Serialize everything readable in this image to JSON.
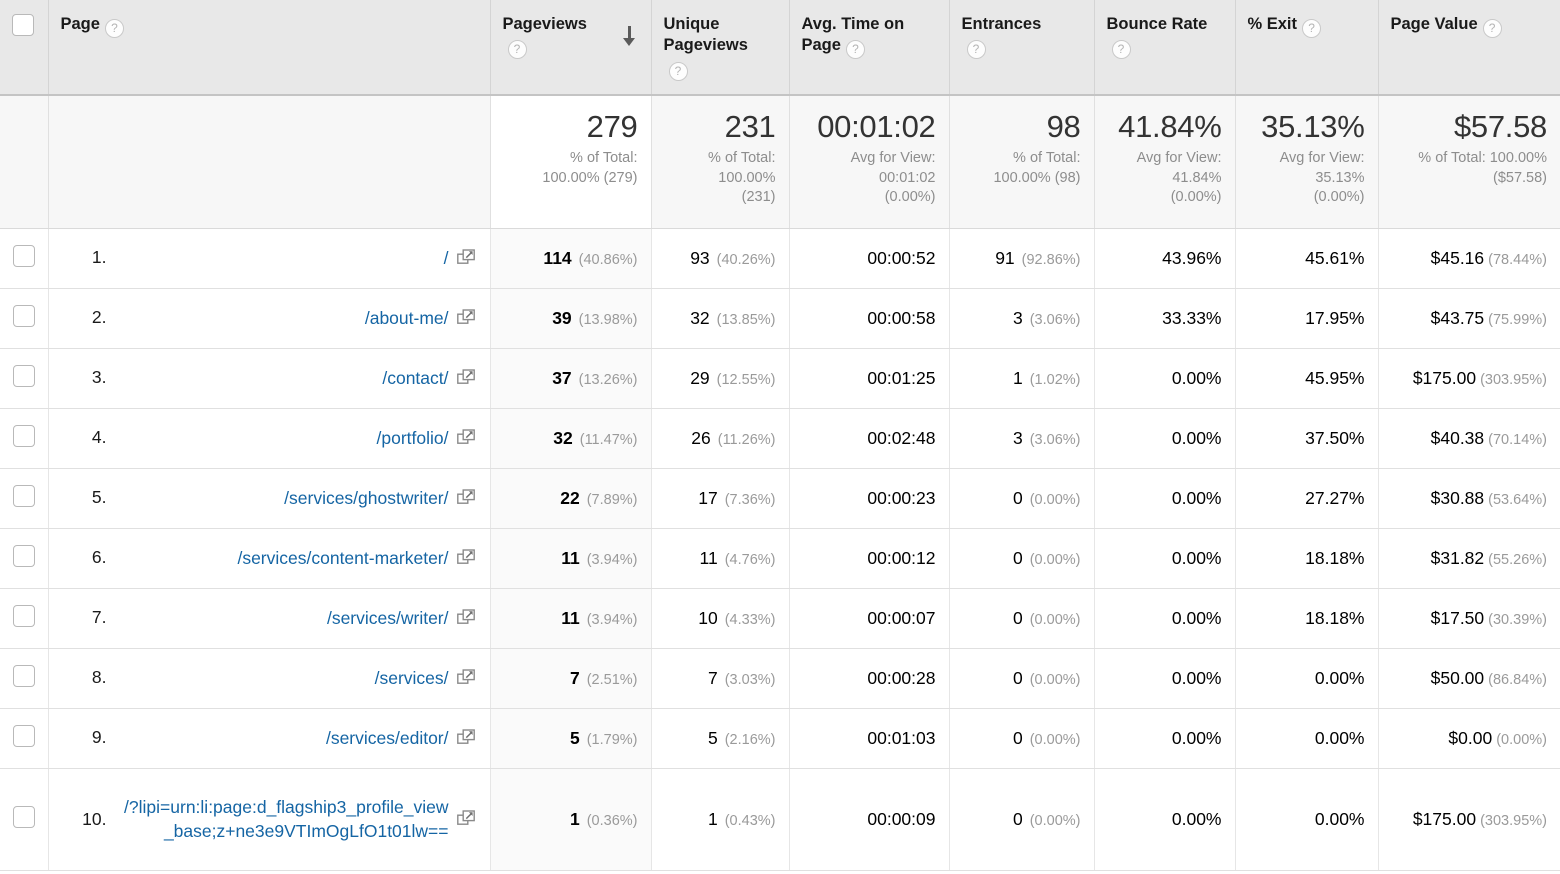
{
  "table": {
    "columns": [
      {
        "key": "checkbox",
        "label": "",
        "help": false
      },
      {
        "key": "page",
        "label": "Page",
        "help": true
      },
      {
        "key": "pageviews",
        "label": "Pageviews",
        "help": true,
        "sorted": true,
        "sort_direction": "descending"
      },
      {
        "key": "unique_pageviews",
        "label": "Unique Pageviews",
        "help": true
      },
      {
        "key": "avg_time_on_page",
        "label": "Avg. Time on Page",
        "help": true
      },
      {
        "key": "entrances",
        "label": "Entrances",
        "help": true
      },
      {
        "key": "bounce_rate",
        "label": "Bounce Rate",
        "help": true
      },
      {
        "key": "pct_exit",
        "label": "% Exit",
        "help": true
      },
      {
        "key": "page_value",
        "label": "Page Value",
        "help": true
      }
    ],
    "help_icon_glyph": "?",
    "sort_icon": "arrow-down-icon",
    "open_icon": "open-in-new-window-icon",
    "summary": {
      "pageviews": {
        "value": "279",
        "line1": "% of Total:",
        "line2": "100.00% (279)"
      },
      "unique_pageviews": {
        "value": "231",
        "line1": "% of Total:",
        "line2": "100.00%",
        "line3": "(231)"
      },
      "avg_time_on_page": {
        "value": "00:01:02",
        "line1": "Avg for View:",
        "line2": "00:01:02",
        "line3": "(0.00%)"
      },
      "entrances": {
        "value": "98",
        "line1": "% of Total:",
        "line2": "100.00% (98)"
      },
      "bounce_rate": {
        "value": "41.84%",
        "line1": "Avg for View:",
        "line2": "41.84%",
        "line3": "(0.00%)"
      },
      "pct_exit": {
        "value": "35.13%",
        "line1": "Avg for View:",
        "line2": "35.13%",
        "line3": "(0.00%)"
      },
      "page_value": {
        "value": "$57.58",
        "line1": "% of Total: 100.00%",
        "line2": "($57.58)"
      }
    },
    "rows": [
      {
        "rank": "1.",
        "page": "/",
        "pageviews": "114",
        "pageviews_pct": "(40.86%)",
        "unique_pageviews": "93",
        "unique_pageviews_pct": "(40.26%)",
        "avg_time_on_page": "00:00:52",
        "entrances": "91",
        "entrances_pct": "(92.86%)",
        "bounce_rate": "43.96%",
        "pct_exit": "45.61%",
        "page_value": "$45.16",
        "page_value_pct": "(78.44%)"
      },
      {
        "rank": "2.",
        "page": "/about-me/",
        "pageviews": "39",
        "pageviews_pct": "(13.98%)",
        "unique_pageviews": "32",
        "unique_pageviews_pct": "(13.85%)",
        "avg_time_on_page": "00:00:58",
        "entrances": "3",
        "entrances_pct": "(3.06%)",
        "bounce_rate": "33.33%",
        "pct_exit": "17.95%",
        "page_value": "$43.75",
        "page_value_pct": "(75.99%)"
      },
      {
        "rank": "3.",
        "page": "/contact/",
        "pageviews": "37",
        "pageviews_pct": "(13.26%)",
        "unique_pageviews": "29",
        "unique_pageviews_pct": "(12.55%)",
        "avg_time_on_page": "00:01:25",
        "entrances": "1",
        "entrances_pct": "(1.02%)",
        "bounce_rate": "0.00%",
        "pct_exit": "45.95%",
        "page_value": "$175.00",
        "page_value_pct": "(303.95%)"
      },
      {
        "rank": "4.",
        "page": "/portfolio/",
        "pageviews": "32",
        "pageviews_pct": "(11.47%)",
        "unique_pageviews": "26",
        "unique_pageviews_pct": "(11.26%)",
        "avg_time_on_page": "00:02:48",
        "entrances": "3",
        "entrances_pct": "(3.06%)",
        "bounce_rate": "0.00%",
        "pct_exit": "37.50%",
        "page_value": "$40.38",
        "page_value_pct": "(70.14%)"
      },
      {
        "rank": "5.",
        "page": "/services/ghostwriter/",
        "pageviews": "22",
        "pageviews_pct": "(7.89%)",
        "unique_pageviews": "17",
        "unique_pageviews_pct": "(7.36%)",
        "avg_time_on_page": "00:00:23",
        "entrances": "0",
        "entrances_pct": "(0.00%)",
        "bounce_rate": "0.00%",
        "pct_exit": "27.27%",
        "page_value": "$30.88",
        "page_value_pct": "(53.64%)"
      },
      {
        "rank": "6.",
        "page": "/services/content-marketer/",
        "pageviews": "11",
        "pageviews_pct": "(3.94%)",
        "unique_pageviews": "11",
        "unique_pageviews_pct": "(4.76%)",
        "avg_time_on_page": "00:00:12",
        "entrances": "0",
        "entrances_pct": "(0.00%)",
        "bounce_rate": "0.00%",
        "pct_exit": "18.18%",
        "page_value": "$31.82",
        "page_value_pct": "(55.26%)"
      },
      {
        "rank": "7.",
        "page": "/services/writer/",
        "pageviews": "11",
        "pageviews_pct": "(3.94%)",
        "unique_pageviews": "10",
        "unique_pageviews_pct": "(4.33%)",
        "avg_time_on_page": "00:00:07",
        "entrances": "0",
        "entrances_pct": "(0.00%)",
        "bounce_rate": "0.00%",
        "pct_exit": "18.18%",
        "page_value": "$17.50",
        "page_value_pct": "(30.39%)"
      },
      {
        "rank": "8.",
        "page": "/services/",
        "pageviews": "7",
        "pageviews_pct": "(2.51%)",
        "unique_pageviews": "7",
        "unique_pageviews_pct": "(3.03%)",
        "avg_time_on_page": "00:00:28",
        "entrances": "0",
        "entrances_pct": "(0.00%)",
        "bounce_rate": "0.00%",
        "pct_exit": "0.00%",
        "page_value": "$50.00",
        "page_value_pct": "(86.84%)"
      },
      {
        "rank": "9.",
        "page": "/services/editor/",
        "pageviews": "5",
        "pageviews_pct": "(1.79%)",
        "unique_pageviews": "5",
        "unique_pageviews_pct": "(2.16%)",
        "avg_time_on_page": "00:01:03",
        "entrances": "0",
        "entrances_pct": "(0.00%)",
        "bounce_rate": "0.00%",
        "pct_exit": "0.00%",
        "page_value": "$0.00",
        "page_value_pct": "(0.00%)"
      },
      {
        "rank": "10.",
        "page": "/?lipi=urn:li:page:d_flagship3_profile_view_base;z+ne3e9VTImOgLfO1t01lw==",
        "pageviews": "1",
        "pageviews_pct": "(0.36%)",
        "unique_pageviews": "1",
        "unique_pageviews_pct": "(0.43%)",
        "avg_time_on_page": "00:00:09",
        "entrances": "0",
        "entrances_pct": "(0.00%)",
        "bounce_rate": "0.00%",
        "pct_exit": "0.00%",
        "page_value": "$175.00",
        "page_value_pct": "(303.95%)"
      }
    ]
  },
  "colors": {
    "link": "#1565a4",
    "header_bg": "#e8e8e8",
    "summary_bg": "#f7f7f7",
    "sorted_col_bg": "#fafafa",
    "muted_text": "#9a9a9a"
  }
}
